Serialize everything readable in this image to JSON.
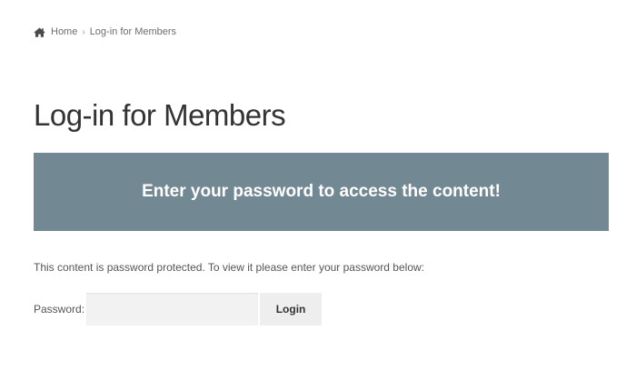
{
  "breadcrumb": {
    "home_label": "Home",
    "separator": "›",
    "current": "Log-in for Members",
    "home_icon": "home-icon"
  },
  "page": {
    "title": "Log-in for Members"
  },
  "banner": {
    "text": "Enter your password to access the content!",
    "color": "#728893"
  },
  "form": {
    "notice": "This content is password protected. To view it please enter your password below:",
    "password_label": "Password:",
    "password_value": "",
    "login_label": "Login"
  }
}
